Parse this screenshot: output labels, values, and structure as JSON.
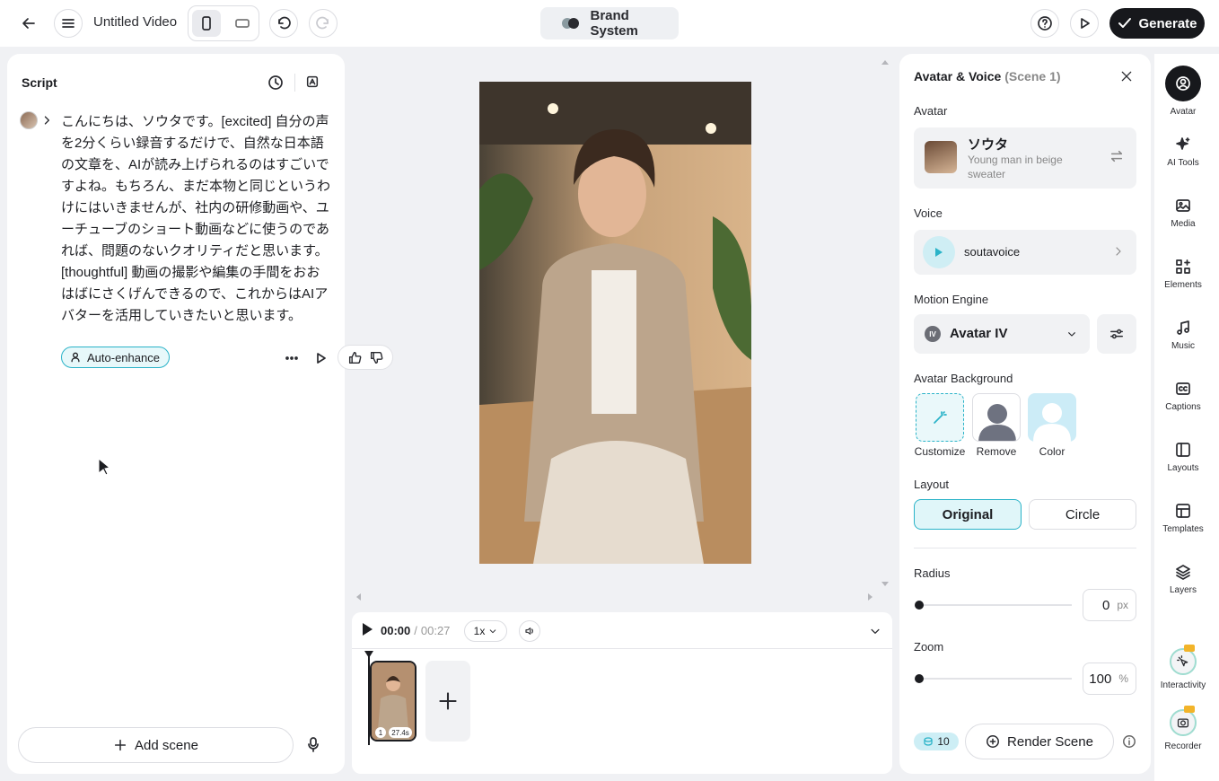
{
  "topbar": {
    "title": "Untitled Video",
    "brand": "Brand System",
    "generate": "Generate"
  },
  "script": {
    "heading": "Script",
    "text": "こんにちは、ソウタです。[excited] 自分の声を2分くらい録音するだけで、自然な日本語の文章を、AIが読み上げられるのはすごいですよね。もちろん、まだ本物と同じというわけにはいきませんが、社内の研修動画や、ユーチューブのショート動画などに使うのであれば、問題のないクオリティだと思います。[thoughtful] 動画の撮影や編集の手間をおおはばにさくげんできるので、これからはAIアバターを活用していきたいと思います。",
    "auto_enhance": "Auto-enhance",
    "add_scene": "Add scene"
  },
  "timeline": {
    "current": "00:00",
    "separator": "/",
    "total": "00:27",
    "speed": "1x",
    "scene_number": "1",
    "scene_duration": "27.4s"
  },
  "panel": {
    "title": "Avatar & Voice",
    "scene": "(Scene 1)",
    "avatar_label": "Avatar",
    "avatar_name": "ソウタ",
    "avatar_desc": "Young man in beige sweater",
    "voice_label": "Voice",
    "voice_name": "soutavoice",
    "motion_label": "Motion Engine",
    "motion_value": "Avatar IV",
    "motion_badge": "IV",
    "bg_label": "Avatar Background",
    "bg_options": [
      "Customize",
      "Remove",
      "Color"
    ],
    "layout_label": "Layout",
    "layout_options": [
      "Original",
      "Circle"
    ],
    "radius_label": "Radius",
    "radius_value": "0",
    "radius_unit": "px",
    "zoom_label": "Zoom",
    "zoom_value": "100",
    "zoom_unit": "%",
    "credits": "10",
    "render": "Render Scene"
  },
  "sidebar": {
    "items": [
      "Avatar",
      "AI Tools",
      "Media",
      "Elements",
      "Music",
      "Captions",
      "Layouts",
      "Templates",
      "Layers",
      "Interactivity",
      "Recorder"
    ]
  },
  "colors": {
    "accent": "#2ab3c8",
    "accent_bg": "#e7f8fa",
    "dark": "#17181c"
  }
}
